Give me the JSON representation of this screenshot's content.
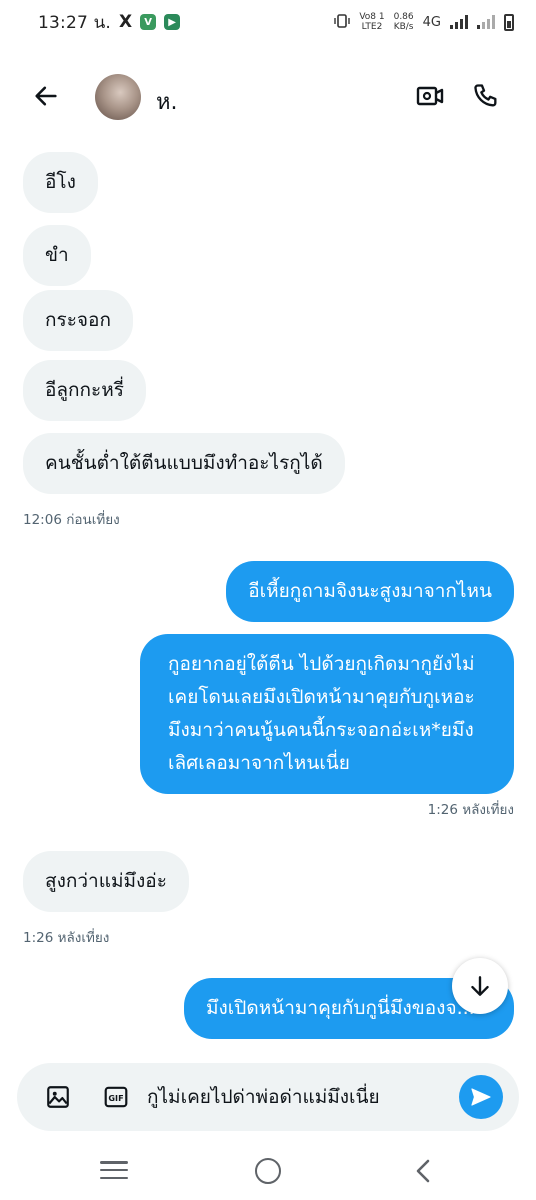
{
  "status_bar": {
    "time": "13:27 น.",
    "app_x": "X",
    "app_v": "V",
    "app_p": "▶",
    "volte_top": "Vo8 1",
    "volte_bottom": "LTE2",
    "speed_top": "0.86",
    "speed_bottom": "KB/s",
    "network": "4G"
  },
  "header": {
    "contact_name": "ห ิ ๋ ҇",
    "contact_display": "ห.",
    "icons": [
      "back-arrow-icon",
      "video-call-icon",
      "phone-icon"
    ]
  },
  "messages": {
    "in_1": "อีโง",
    "in_2": "ขำ",
    "in_3": "กระจอก",
    "in_4": "อีลูกกะหรี่",
    "in_5": "คนชั้นต่ำใต้ตีนแบบมึงทำอะไรกูได้",
    "ts_1": "12:06 ก่อนเที่ยง",
    "out_1": "อีเหี้ยกูถามจิงนะสูงมาจากไหน",
    "out_2_l1": "กูอยากอยู่ใต้ตีน ไปด้วยกูเกิดมากูยังไม่",
    "out_2_l2": "เคยโดนเลยมึงเปิดหน้ามาคุยกับกูเหอะ",
    "out_2_l3": "มึงมาว่าคนนู้นคนนี้กระจอกอ่ะเห*ยมึง",
    "out_2_l4": "เลิศเลอมาจากไหนเนี่ย",
    "ts_2": "1:26 หลังเที่ยง",
    "in_6": "สูงกว่าแม่มึงอ่ะ",
    "ts_3": "1:26 หลังเที่ยง",
    "out_3": "มึงเปิดหน้ามาคุยกับกูนี่มึงของจ..."
  },
  "composer": {
    "draft_text": "กูไม่เคยไปด่าพ่อด่าแม่มึงเนี่ย",
    "gif_label": "GIF"
  },
  "colors": {
    "accent": "#1d9bf0",
    "incoming_bubble": "#eff3f4",
    "text": "#0f1419",
    "muted": "#536471"
  }
}
